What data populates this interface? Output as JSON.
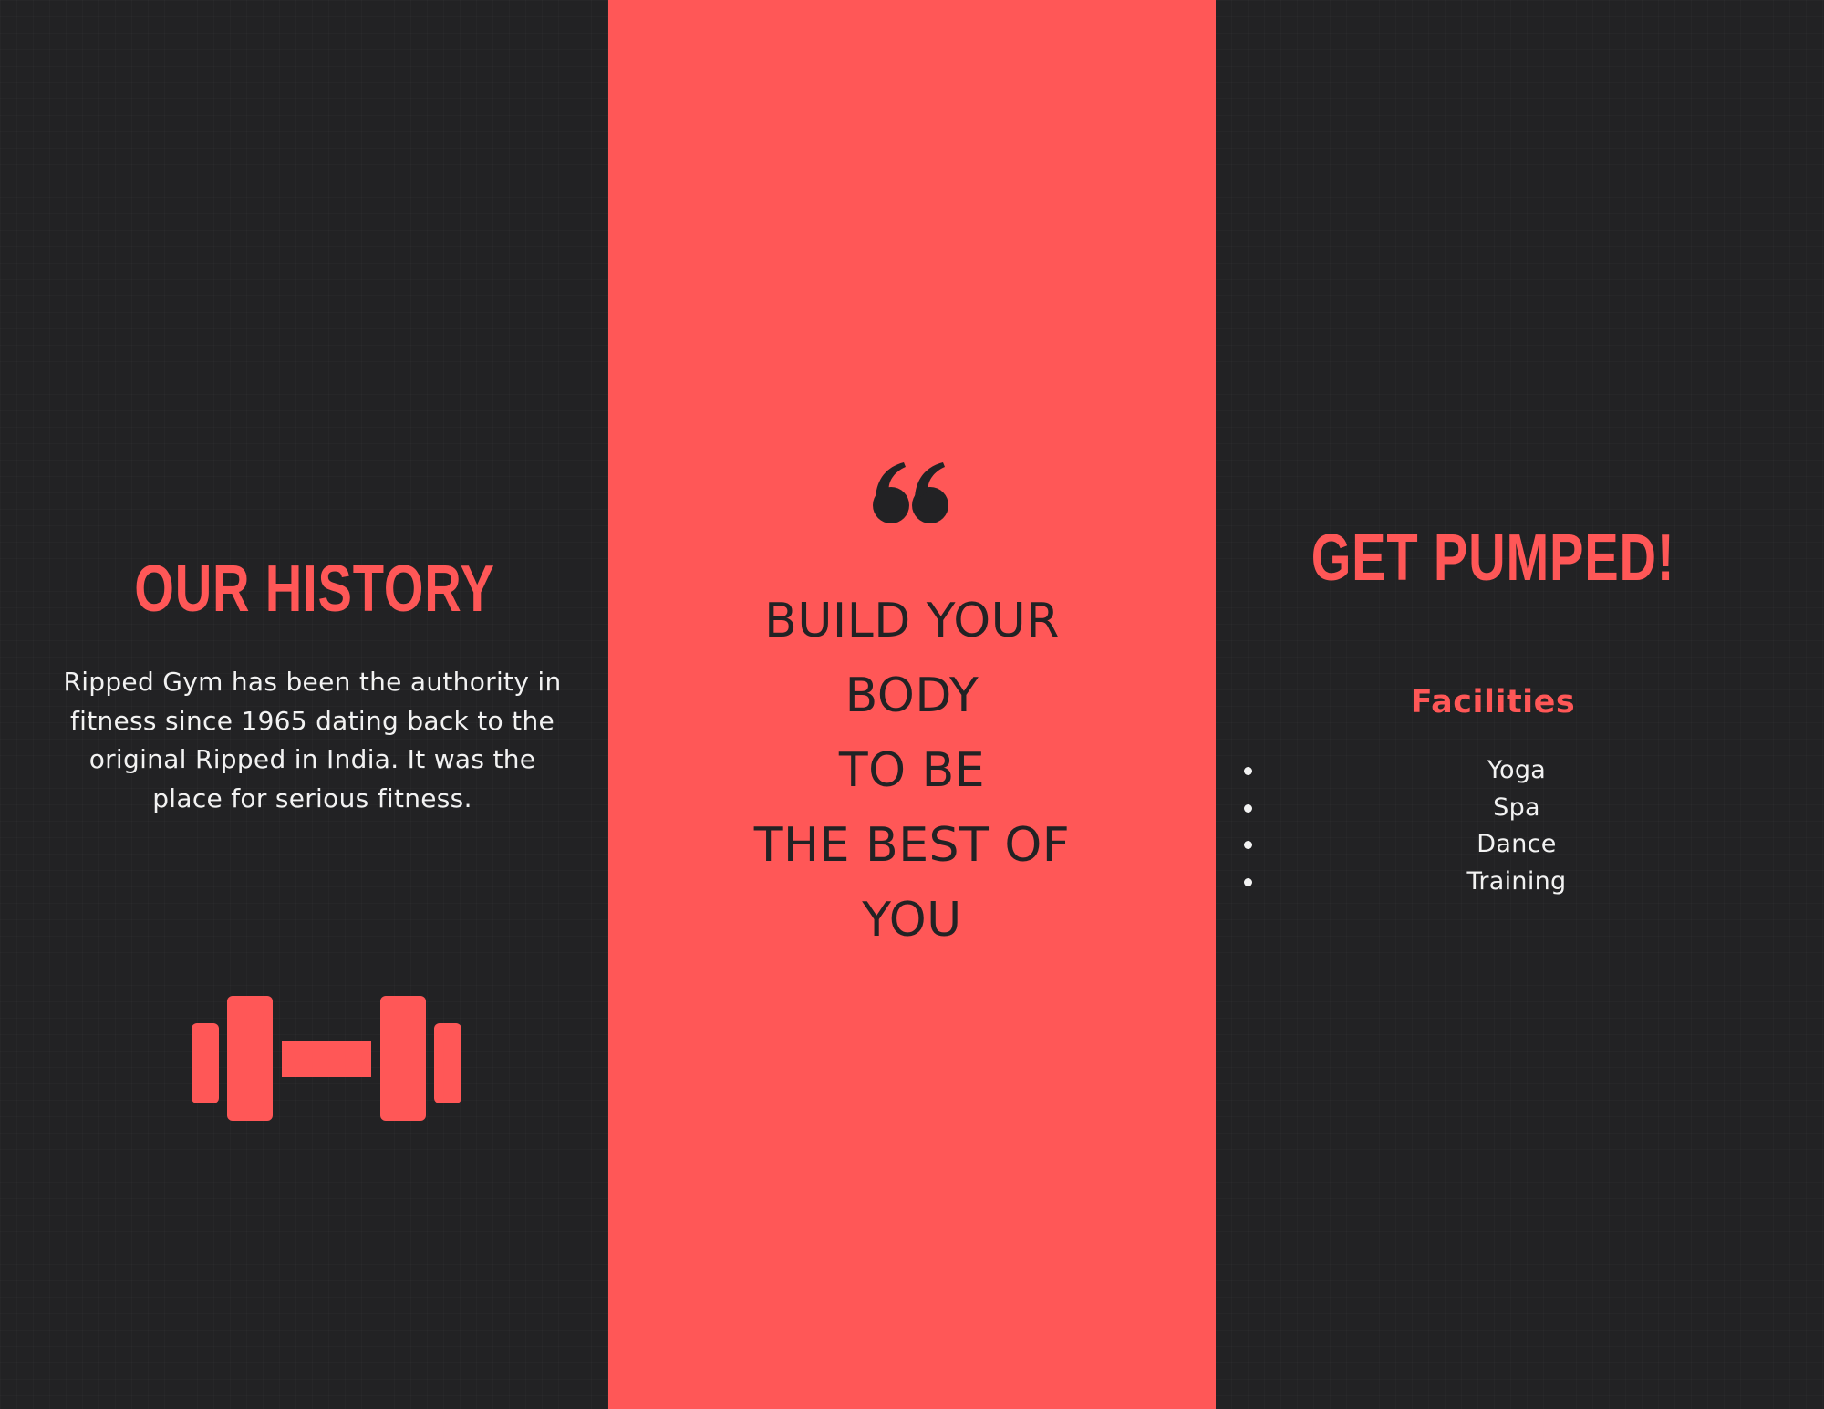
{
  "left_panel": {
    "heading": "OUR HISTORY",
    "body": "Ripped Gym has been the authority in fitness since 1965 dating back to the original Ripped in India. It was the place for serious fitness.",
    "icon": "dumbbell-icon"
  },
  "center_panel": {
    "icon": "quote-mark-icon",
    "quote_lines": [
      "BUILD YOUR",
      "BODY",
      "TO BE",
      "THE BEST OF",
      "YOU"
    ]
  },
  "right_panel": {
    "heading": "GET PUMPED!",
    "subheading": "Facilities",
    "items": [
      "Yoga",
      "Spa",
      "Dance",
      "Training"
    ]
  },
  "colors": {
    "background": "#222224",
    "accent": "#ff5757",
    "text_light": "#f2f2f2",
    "text_dark": "#222224"
  }
}
